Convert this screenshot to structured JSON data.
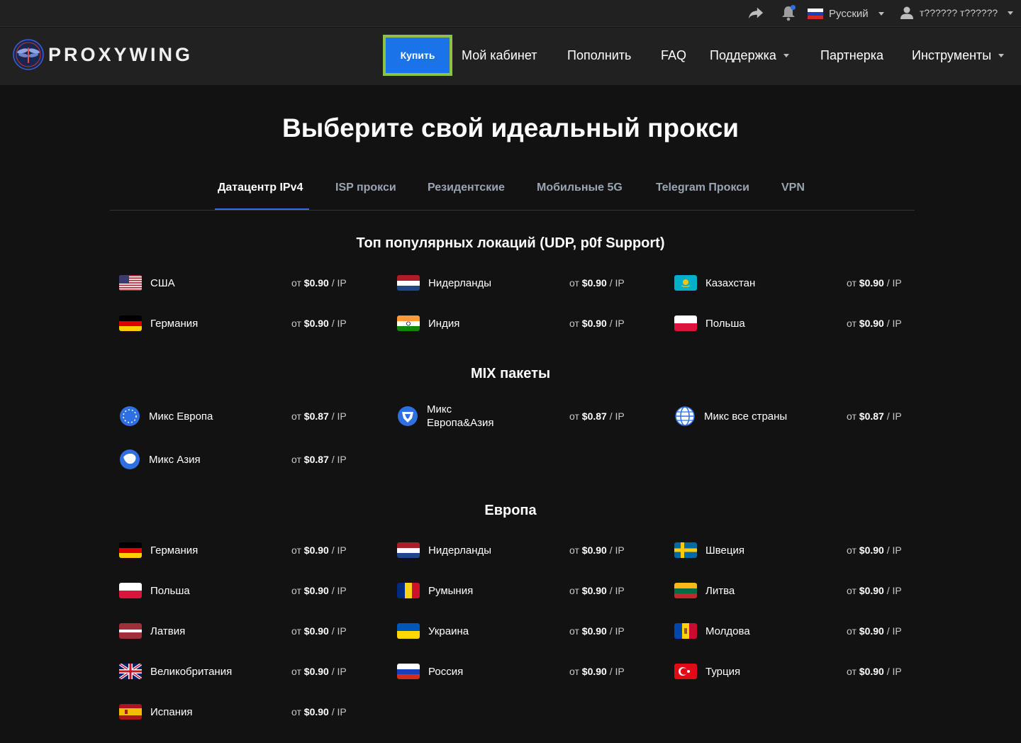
{
  "topbar": {
    "language": "Русский",
    "username": "т?????? т??????"
  },
  "header": {
    "logo": "PROXYWING",
    "nav": {
      "buy": "Купить",
      "cabinet": "Мой кабинет",
      "topup": "Пополнить",
      "faq": "FAQ",
      "support": "Поддержка",
      "partner": "Партнерка",
      "tools": "Инструменты"
    }
  },
  "hero": {
    "title": "Выберите свой идеальный прокси"
  },
  "tabs": [
    "Датацентр IPv4",
    "ISP прокси",
    "Резидентские",
    "Мобильные 5G",
    "Telegram Прокси",
    "VPN"
  ],
  "price_prefix": "от",
  "price_suffix": "/ IP",
  "sections": {
    "top": {
      "title": "Топ популярных локаций (UDP, p0f Support)",
      "items": [
        {
          "name": "США",
          "price": "$0.90",
          "flag": "us"
        },
        {
          "name": "Нидерланды",
          "price": "$0.90",
          "flag": "nl"
        },
        {
          "name": "Казахстан",
          "price": "$0.90",
          "flag": "kz"
        },
        {
          "name": "Германия",
          "price": "$0.90",
          "flag": "de"
        },
        {
          "name": "Индия",
          "price": "$0.90",
          "flag": "in"
        },
        {
          "name": "Польша",
          "price": "$0.90",
          "flag": "pl"
        }
      ]
    },
    "mix": {
      "title": "MIX пакеты",
      "items": [
        {
          "name": "Микс Европа",
          "price": "$0.87",
          "flag": "globe-europe"
        },
        {
          "name": "Микс Европа&Азия",
          "price": "$0.87",
          "flag": "globe-euasia"
        },
        {
          "name": "Микс все страны",
          "price": "$0.87",
          "flag": "globe-world"
        },
        {
          "name": "Микс Азия",
          "price": "$0.87",
          "flag": "globe-asia"
        }
      ]
    },
    "europe": {
      "title": "Европа",
      "items": [
        {
          "name": "Германия",
          "price": "$0.90",
          "flag": "de"
        },
        {
          "name": "Нидерланды",
          "price": "$0.90",
          "flag": "nl"
        },
        {
          "name": "Швеция",
          "price": "$0.90",
          "flag": "se"
        },
        {
          "name": "Польша",
          "price": "$0.90",
          "flag": "pl"
        },
        {
          "name": "Румыния",
          "price": "$0.90",
          "flag": "ro"
        },
        {
          "name": "Литва",
          "price": "$0.90",
          "flag": "lt"
        },
        {
          "name": "Латвия",
          "price": "$0.90",
          "flag": "lv"
        },
        {
          "name": "Украина",
          "price": "$0.90",
          "flag": "ua"
        },
        {
          "name": "Молдова",
          "price": "$0.90",
          "flag": "md"
        },
        {
          "name": "Великобритания",
          "price": "$0.90",
          "flag": "gb"
        },
        {
          "name": "Россия",
          "price": "$0.90",
          "flag": "ru"
        },
        {
          "name": "Турция",
          "price": "$0.90",
          "flag": "tr"
        },
        {
          "name": "Испания",
          "price": "$0.90",
          "flag": "es"
        }
      ]
    }
  }
}
